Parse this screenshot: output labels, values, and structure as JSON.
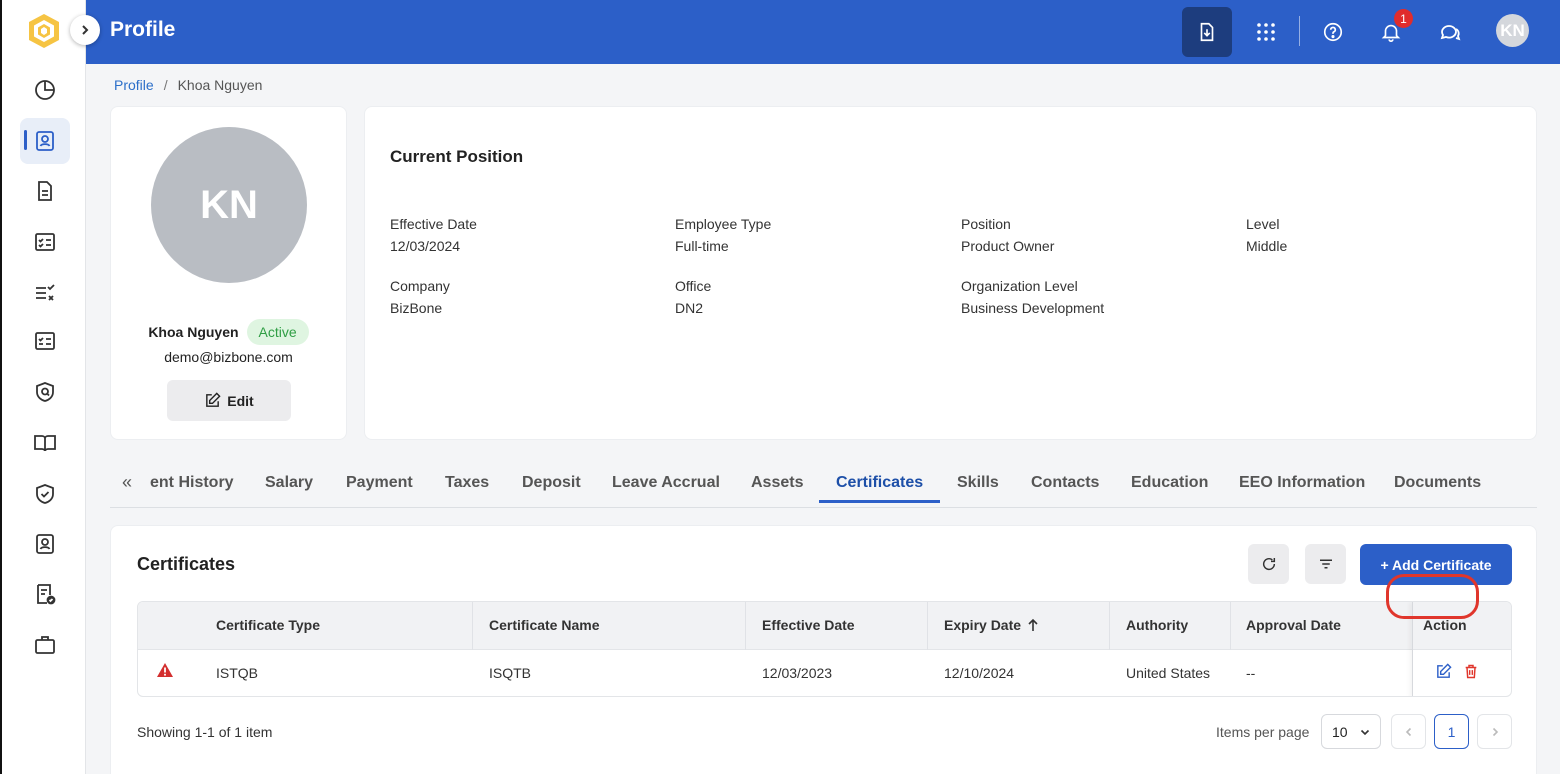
{
  "header": {
    "title": "Profile",
    "notification_count": "1",
    "user_initials": "KN"
  },
  "breadcrumb": {
    "parent": "Profile",
    "current": "Khoa Nguyen"
  },
  "profile": {
    "initials": "KN",
    "name": "Khoa Nguyen",
    "status": "Active",
    "email": "demo@bizbone.com",
    "edit_label": "Edit"
  },
  "position": {
    "title": "Current Position",
    "fields": [
      {
        "label": "Effective Date",
        "value": "12/03/2024"
      },
      {
        "label": "Employee Type",
        "value": "Full-time"
      },
      {
        "label": "Position",
        "value": "Product Owner"
      },
      {
        "label": "Level",
        "value": "Middle"
      },
      {
        "label": "Company",
        "value": "BizBone"
      },
      {
        "label": "Office",
        "value": "DN2"
      },
      {
        "label": "Organization Level",
        "value": "Business Development"
      }
    ]
  },
  "tabs": [
    {
      "label": "ent History"
    },
    {
      "label": "Salary"
    },
    {
      "label": "Payment"
    },
    {
      "label": "Taxes"
    },
    {
      "label": "Deposit"
    },
    {
      "label": "Leave Accrual"
    },
    {
      "label": "Assets"
    },
    {
      "label": "Certificates"
    },
    {
      "label": "Skills"
    },
    {
      "label": "Contacts"
    },
    {
      "label": "Education"
    },
    {
      "label": "EEO Information"
    },
    {
      "label": "Documents"
    }
  ],
  "certificates": {
    "title": "Certificates",
    "add_label": "+ Add Certificate",
    "columns": [
      "Certificate Type",
      "Certificate Name",
      "Effective Date",
      "Expiry Date",
      "Authority",
      "Approval Date",
      "Action"
    ],
    "rows": [
      {
        "type": "ISTQB",
        "name": "ISQTB",
        "effective": "12/03/2023",
        "expiry": "12/10/2024",
        "authority": "United States",
        "approval": "--"
      }
    ],
    "showing": "Showing 1-1 of 1 item",
    "items_per_page_label": "Items per page",
    "items_per_page": "10",
    "current_page": "1"
  },
  "colors": {
    "primary": "#2c5fc8",
    "danger": "#e0362c",
    "active_green": "#2f9e44"
  }
}
